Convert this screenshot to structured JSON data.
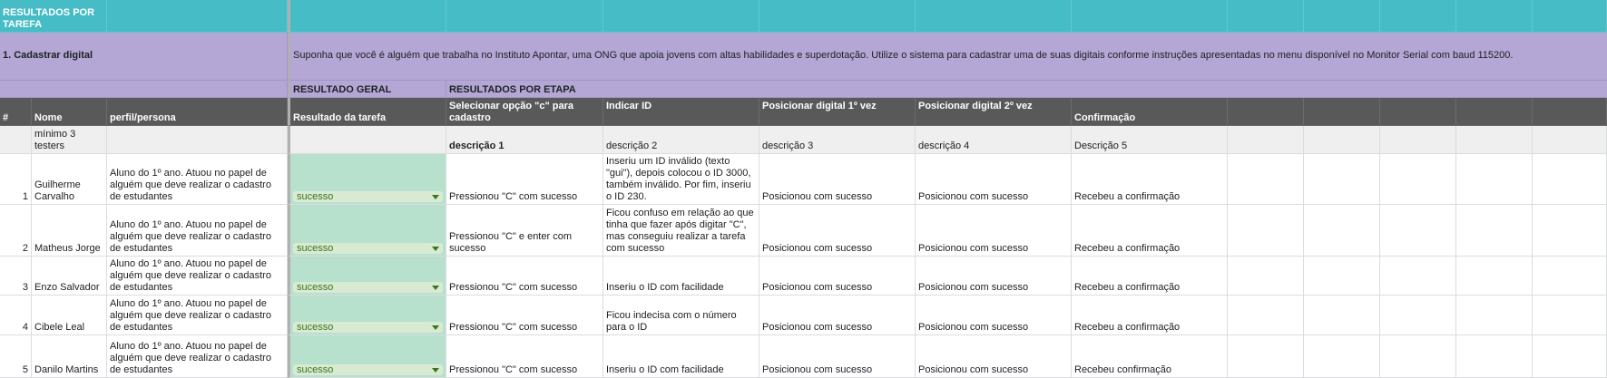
{
  "section_header": "RESULTADOS POR TAREFA",
  "task": {
    "title": "1. Cadastrar digital",
    "description": "Suponha que você é alguém que trabalha no Instituto Apontar, uma ONG que apoia jovens com altas habilidades e superdotação. Utilize o sistema para cadastrar uma de suas digitais conforme instruções apresentadas no menu disponível no Monitor Serial com baud 115200."
  },
  "group_headers": {
    "general": "RESULTADO GERAL",
    "by_step": "RESULTADOS POR ETAPA"
  },
  "columns": {
    "num": "#",
    "name": "Nome",
    "persona": "perfil/persona",
    "result": "Resultado da tarefa",
    "step1": "Selecionar opção \"c\" para cadastro",
    "step2": "Indicar ID",
    "step3": "Posicionar digital 1º vez",
    "step4": "Posicionar digital 2º vez",
    "step5": "Confirmação"
  },
  "hint_row": {
    "name": "mínimo 3 testers",
    "step1": "descrição 1",
    "step2": "descrição 2",
    "step3": "descrição 3",
    "step4": "descrição 4",
    "step5": "Descrição 5"
  },
  "rows": [
    {
      "num": "1",
      "name": "Guilherme Carvalho",
      "persona": "Aluno do 1º ano. Atuou no papel de alguém que deve realizar o cadastro de estudantes",
      "result": "sucesso",
      "step1": "Pressionou \"C\" com sucesso",
      "step2": "Inseriu um ID inválido (texto \"gui\"), depois colocou o ID 3000, também inválido. Por fim, inseriu o ID 230.",
      "step3": "Posicionou com sucesso",
      "step4": "Posicionou com sucesso",
      "step5": "Recebeu a confirmação"
    },
    {
      "num": "2",
      "name": "Matheus Jorge",
      "persona": "Aluno do 1º ano. Atuou no papel de alguém que deve realizar o cadastro de estudantes",
      "result": "sucesso",
      "step1": "Pressionou \"C\" e enter com sucesso",
      "step2": "Ficou confuso em relação ao que tinha que fazer após digitar \"C\", mas conseguiu realizar a tarefa com sucesso",
      "step3": "Posicionou com sucesso",
      "step4": "Posicionou com sucesso",
      "step5": "Recebeu a confirmação"
    },
    {
      "num": "3",
      "name": "Enzo Salvador",
      "persona": "Aluno do 1º ano. Atuou no papel de alguém que deve realizar o cadastro de estudantes",
      "result": "sucesso",
      "step1": "Pressionou \"C\" com sucesso",
      "step2": "Inseriu o ID com facilidade",
      "step3": "Posicionou com sucesso",
      "step4": "Posicionou com sucesso",
      "step5": "Recebeu a confirmação"
    },
    {
      "num": "4",
      "name": "Cibele Leal",
      "persona": "Aluno do 1º ano. Atuou no papel de alguém que deve realizar o cadastro de estudantes",
      "result": "sucesso",
      "step1": "Pressionou \"C\" com sucesso",
      "step2": "Ficou indecisa com o número para o ID",
      "step3": "Posicionou com sucesso",
      "step4": "Posicionou com sucesso",
      "step5": "Recebeu a confirmação"
    },
    {
      "num": "5",
      "name": "Danilo Martins",
      "persona": "Aluno do 1º ano. Atuou no papel de alguém que deve realizar o cadastro de estudantes",
      "result": "sucesso",
      "step1": "Pressionou \"C\" com sucesso",
      "step2": "Inseriu o ID com facilidade",
      "step3": "Posicionou com sucesso",
      "step4": "Posicionou com sucesso",
      "step5": "Recebeu confirmação"
    }
  ],
  "colors": {
    "teal": "#46bcc7",
    "purple": "#b4a7d6",
    "header_dark": "#595959",
    "result_green": "#b7e1cd",
    "chip_text": "#38761d"
  }
}
